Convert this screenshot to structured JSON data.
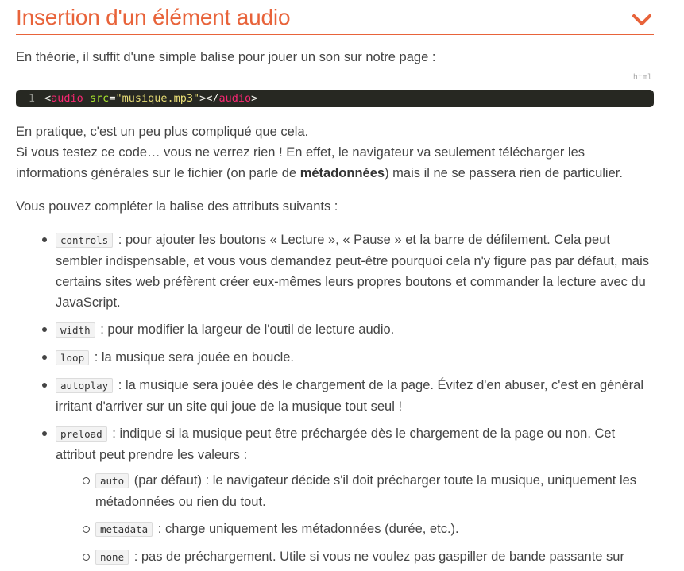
{
  "section": {
    "title": "Insertion d'un élément audio",
    "accent_color": "#e8633a",
    "toggle_icon": "chevron-down-icon"
  },
  "intro": "En théorie, il suffit d'une simple balise pour jouer un son sur notre page :",
  "code": {
    "language": "html",
    "line_number": "1",
    "tokens": {
      "open_lt": "<",
      "tag": "audio",
      "attr": "src",
      "eq": "=",
      "value": "\"musique.mp3\"",
      "mid": "></",
      "close_tag": "audio",
      "close_gt": ">"
    }
  },
  "p_practice": "En pratique, c'est un peu plus compliqué que cela.",
  "p_test_before": "Si vous testez ce code… vous ne verrez rien ! En effet, le navigateur va seulement télécharger les informations générales sur le fichier (on parle de ",
  "p_test_bold": "métadonnées",
  "p_test_after": ") mais il ne se passera rien de particulier.",
  "p_attrs_intro": "Vous pouvez compléter la balise des attributs suivants :",
  "attributes": [
    {
      "code": "controls",
      "text": " : pour ajouter les boutons « Lecture », « Pause » et la barre de défilement. Cela peut sembler indispensable, et vous vous demandez peut-être pourquoi cela n'y figure pas par défaut, mais certains sites web préfèrent créer eux-mêmes leurs propres boutons et commander la lecture avec du JavaScript."
    },
    {
      "code": "width",
      "text": " : pour modifier la largeur de l'outil de lecture audio."
    },
    {
      "code": "loop",
      "text": " : la musique sera jouée en boucle."
    },
    {
      "code": "autoplay",
      "text": " : la musique sera jouée dès le chargement de la page. Évitez d'en abuser, c'est en général irritant d'arriver sur un site qui joue de la musique tout seul !"
    },
    {
      "code": "preload",
      "text": " : indique si la musique peut être préchargée dès le chargement de la page ou non. Cet attribut peut prendre les valeurs :"
    }
  ],
  "preload_values": [
    {
      "code": "auto",
      "text": " (par défaut) : le navigateur décide s'il doit précharger toute la musique, uniquement les métadonnées ou rien du tout."
    },
    {
      "code": "metadata",
      "text": " : charge uniquement les métadonnées (durée, etc.)."
    },
    {
      "code": "none",
      "text": " : pas de préchargement. Utile si vous ne voulez pas gaspiller de bande passante sur votre site."
    }
  ]
}
